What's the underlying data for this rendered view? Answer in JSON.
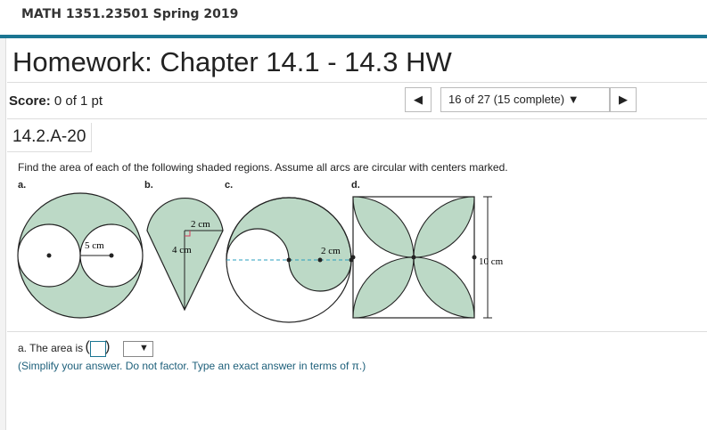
{
  "header": {
    "course": "MATH 1351.23501 Spring 2019"
  },
  "assignment": {
    "title": "Homework: Chapter 14.1 - 14.3 HW"
  },
  "score": {
    "label": "Score:",
    "value": "0 of 1 pt"
  },
  "nav": {
    "prev_glyph": "◀",
    "next_glyph": "▶",
    "position": "16 of 27 (15 complete) ▼"
  },
  "question": {
    "id": "14.2.A-20",
    "instruction": "Find the area of each of the following shaded regions. Assume all arcs are circular with centers marked.",
    "labels": [
      "a.",
      "b.",
      "c.",
      "d."
    ],
    "measurements": {
      "a": "5 cm",
      "b_top": "2 cm",
      "b_side": "4 cm",
      "c": "2 cm",
      "d": "10 cm"
    }
  },
  "answer": {
    "prefix": "a. The area is",
    "dropdown_glyph": "▼",
    "note": "(Simplify your answer. Do not factor. Type an exact answer in terms of π.)"
  },
  "colors": {
    "accent": "#1b7592",
    "shade": "#bcd9c6"
  }
}
